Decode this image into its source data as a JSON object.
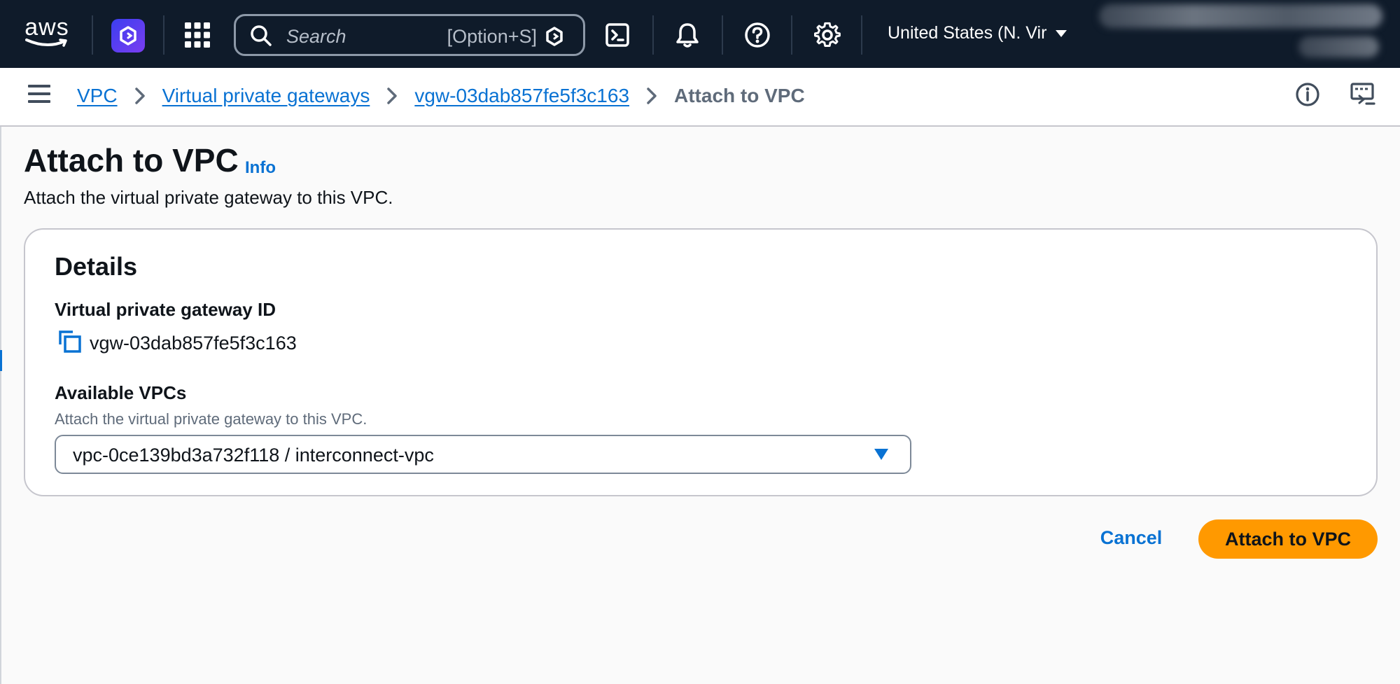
{
  "topnav": {
    "logo_text": "aws",
    "search": {
      "placeholder": "Search",
      "shortcut": "[Option+S]"
    },
    "region_label": "United States (N. Vir",
    "icons": [
      "amazon-q-icon",
      "apps-grid-icon",
      "search-icon",
      "cloudshell-icon",
      "bell-icon",
      "help-icon",
      "gear-icon",
      "caret-down-icon"
    ]
  },
  "breadcrumbs": {
    "items": [
      {
        "label": "VPC"
      },
      {
        "label": "Virtual private gateways"
      },
      {
        "label": "vgw-03dab857fe5f3c163"
      }
    ],
    "current": "Attach to VPC"
  },
  "page": {
    "title": "Attach to VPC",
    "info_link": "Info",
    "description": "Attach the virtual private gateway to this VPC."
  },
  "details": {
    "title": "Details",
    "gateway_id_label": "Virtual private gateway ID",
    "gateway_id_value": "vgw-03dab857fe5f3c163",
    "vpc_label": "Available VPCs",
    "vpc_description": "Attach the virtual private gateway to this VPC.",
    "vpc_selected": "vpc-0ce139bd3a732f118 / interconnect-vpc"
  },
  "actions": {
    "cancel_label": "Cancel",
    "submit_label": "Attach to VPC"
  },
  "colors": {
    "nav_bg": "#0f1b2a",
    "link": "#0972d3",
    "primary_button": "#ff9900",
    "border": "#c6c6cd"
  }
}
